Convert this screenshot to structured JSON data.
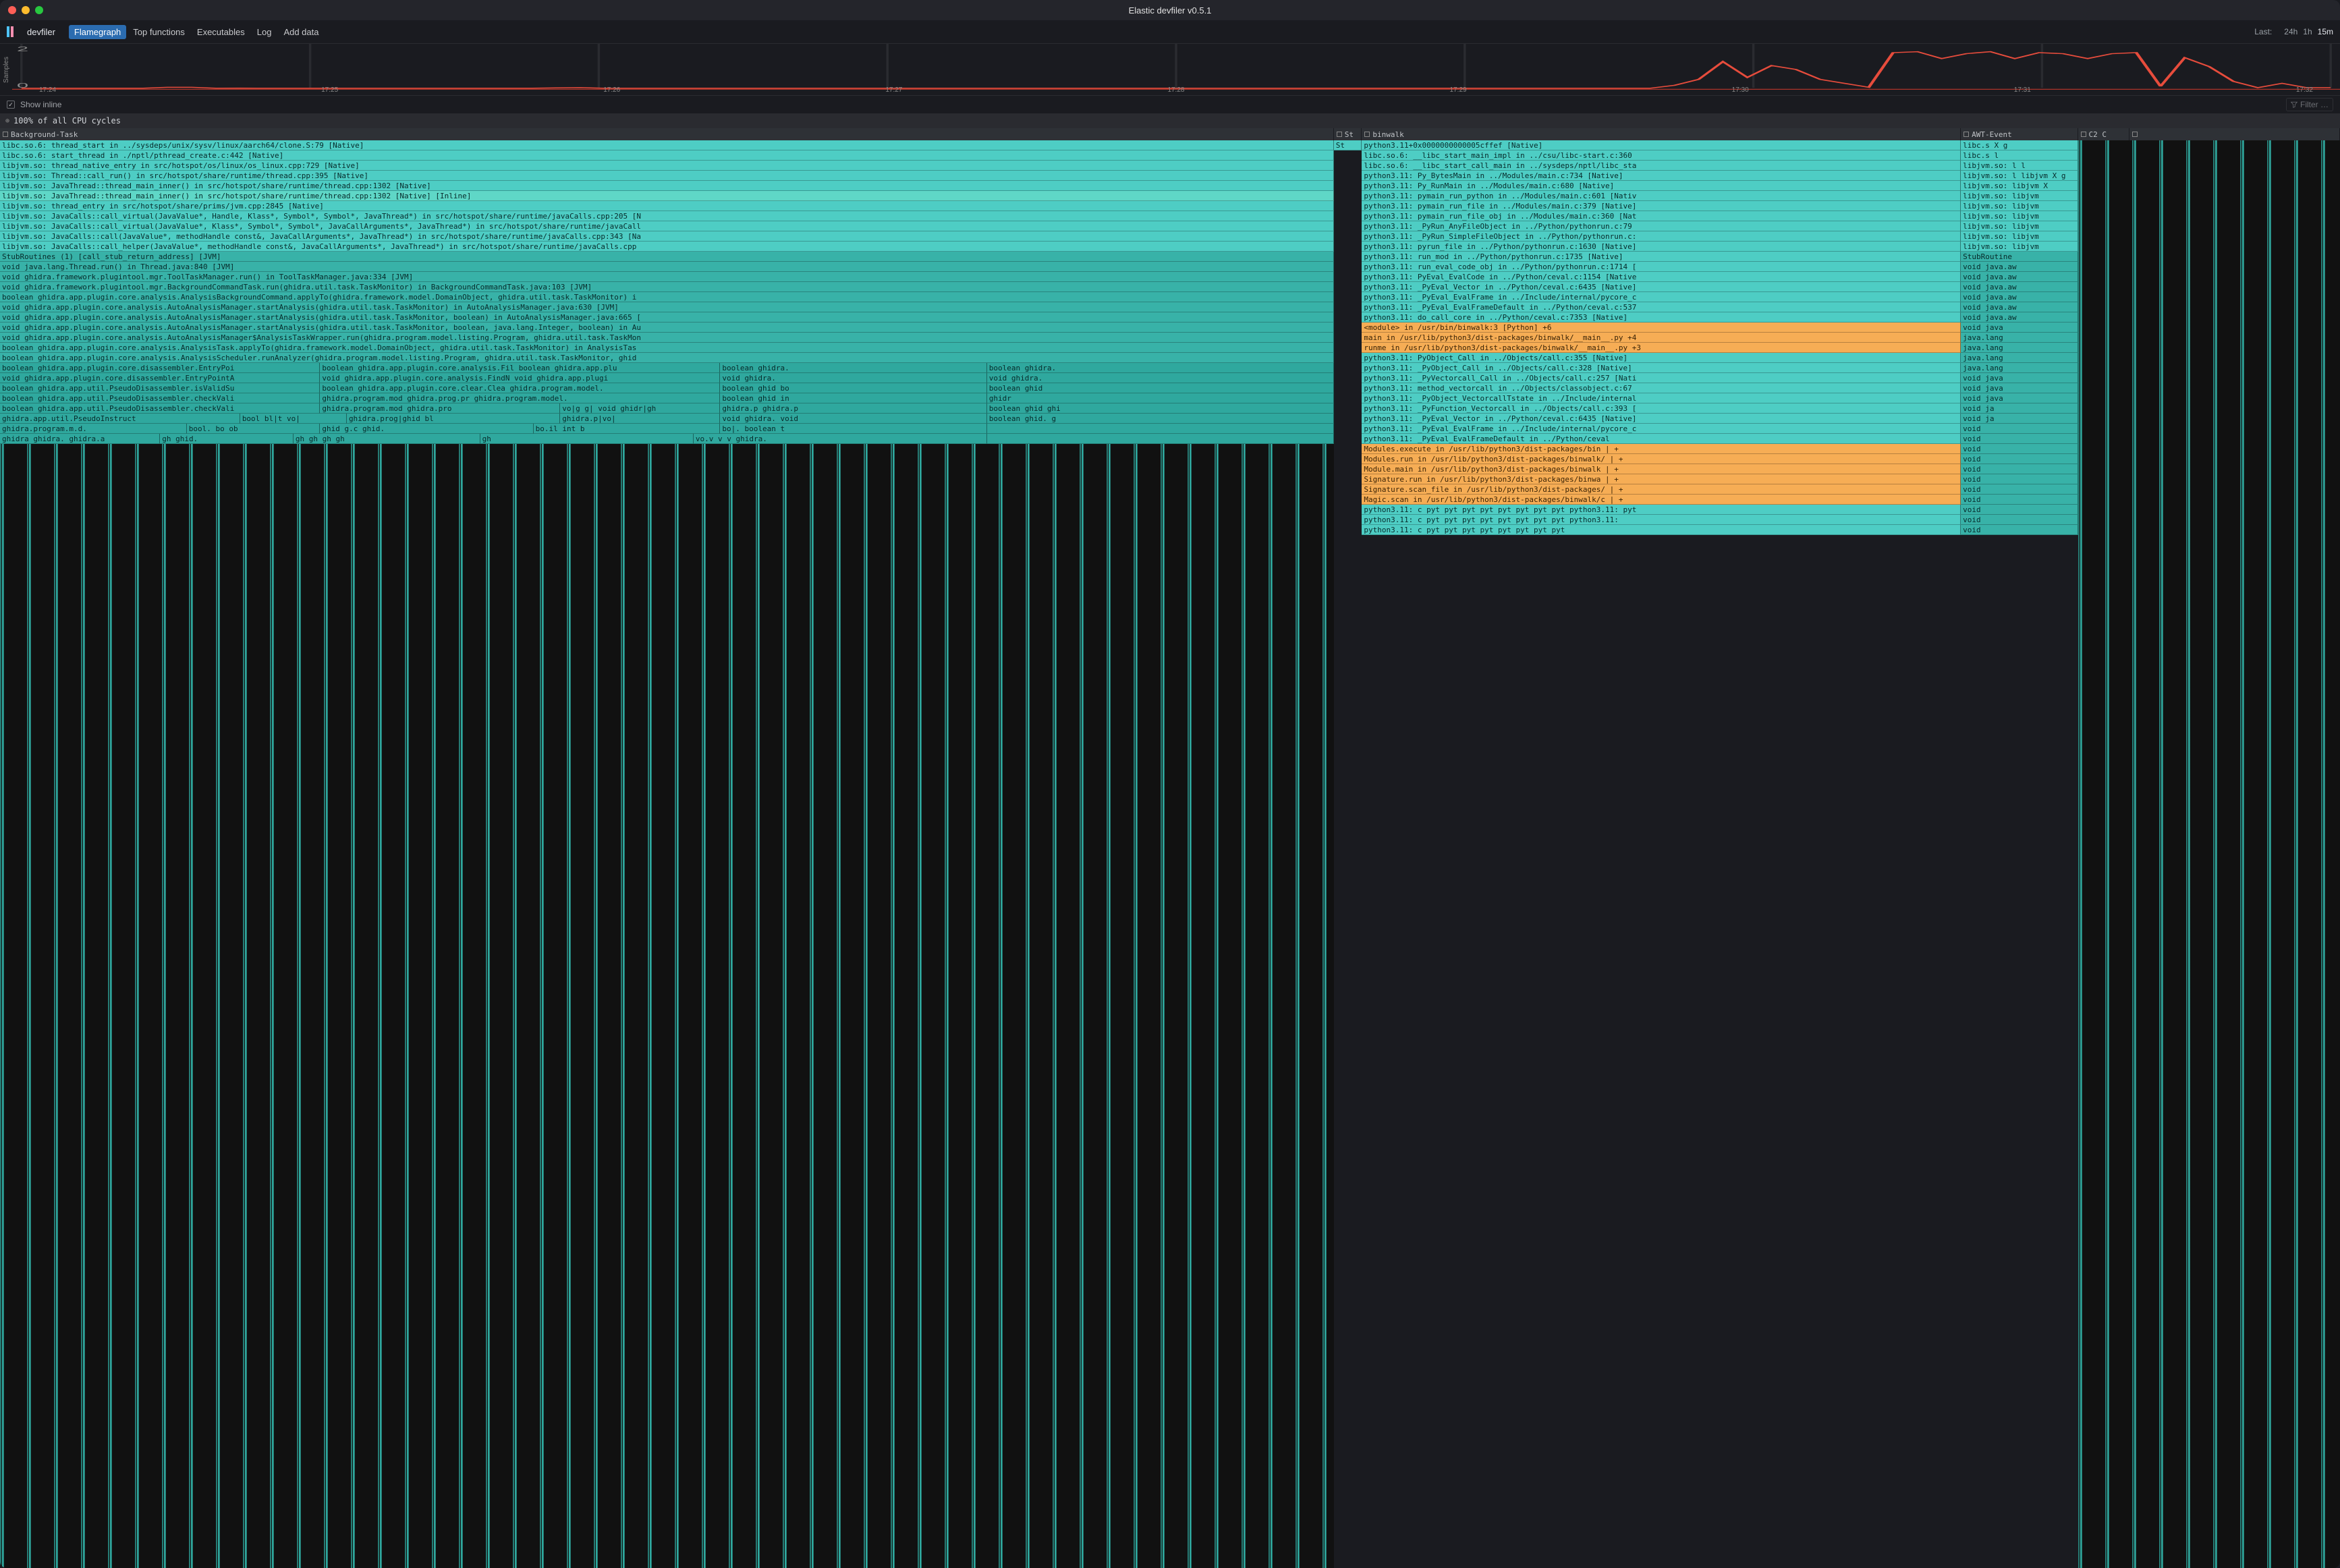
{
  "app": {
    "title": "Elastic devfiler v0.5.1",
    "brand": "devfiler"
  },
  "nav": {
    "items": [
      {
        "label": "Flamegraph",
        "active": true
      },
      {
        "label": "Top functions",
        "active": false
      },
      {
        "label": "Executables",
        "active": false
      },
      {
        "label": "Log",
        "active": false
      },
      {
        "label": "Add data",
        "active": false
      }
    ]
  },
  "time_range": {
    "label": "Last:",
    "options": [
      "24h",
      "1h",
      "15m"
    ],
    "active_index": 2
  },
  "spark": {
    "y_label": "Samples",
    "y_ticks": [
      "2",
      "0"
    ],
    "x_ticks": [
      "17:24",
      "17:25",
      "17:26",
      "17:27",
      "17:28",
      "17:29",
      "17:30",
      "17:31",
      "17:32"
    ]
  },
  "toolbar": {
    "show_inline_checked": true,
    "show_inline_label": "Show inline",
    "filter_placeholder": "Filter …"
  },
  "root": {
    "expand_icon": "⊕",
    "label": "100% of all CPU cycles"
  },
  "columns": [
    {
      "label": "Background-Task",
      "width": 57.0
    },
    {
      "label": "St",
      "width": 1.2
    },
    {
      "label": "binwalk",
      "width": 25.6
    },
    {
      "label": "AWT-Event",
      "width": 5.0
    },
    {
      "label": "C2 C",
      "width": 2.2
    },
    {
      "label": "",
      "width": 9.0
    }
  ],
  "stacks": {
    "java": [
      {
        "class": "c-native",
        "text": "libc.so.6: thread_start in ../sysdeps/unix/sysv/linux/aarch64/clone.S:79 [Native]"
      },
      {
        "class": "c-native",
        "text": "libc.so.6: start_thread in ./nptl/pthread_create.c:442 [Native]"
      },
      {
        "class": "c-native",
        "text": "libjvm.so: thread_native_entry in src/hotspot/os/linux/os_linux.cpp:729 [Native]"
      },
      {
        "class": "c-native",
        "text": "libjvm.so: Thread::call_run() in src/hotspot/share/runtime/thread.cpp:395 [Native]"
      },
      {
        "class": "c-native",
        "text": "libjvm.so: JavaThread::thread_main_inner() in src/hotspot/share/runtime/thread.cpp:1302 [Native]"
      },
      {
        "class": "c-inline",
        "text": "libjvm.so: JavaThread::thread_main_inner() in src/hotspot/share/runtime/thread.cpp:1302 [Native] [Inline]"
      },
      {
        "class": "c-native",
        "text": "libjvm.so: thread_entry in src/hotspot/share/prims/jvm.cpp:2845 [Native]"
      },
      {
        "class": "c-native",
        "text": "libjvm.so: JavaCalls::call_virtual(JavaValue*, Handle, Klass*, Symbol*, Symbol*, JavaThread*) in src/hotspot/share/runtime/javaCalls.cpp:205 [N"
      },
      {
        "class": "c-native",
        "text": "libjvm.so: JavaCalls::call_virtual(JavaValue*, Klass*, Symbol*, Symbol*, JavaCallArguments*, JavaThread*) in src/hotspot/share/runtime/javaCall"
      },
      {
        "class": "c-native",
        "text": "libjvm.so: JavaCalls::call(JavaValue*, methodHandle const&, JavaCallArguments*, JavaThread*) in src/hotspot/share/runtime/javaCalls.cpp:343 [Na"
      },
      {
        "class": "c-native",
        "text": "libjvm.so: JavaCalls::call_helper(JavaValue*, methodHandle const&, JavaCallArguments*, JavaThread*) in src/hotspot/share/runtime/javaCalls.cpp"
      },
      {
        "class": "c-stub",
        "text": "StubRoutines (1) [call_stub_return_address] [JVM]"
      },
      {
        "class": "c-jvm",
        "text": "void java.lang.Thread.run() in Thread.java:840 [JVM]"
      },
      {
        "class": "c-jvm",
        "text": "void ghidra.framework.plugintool.mgr.ToolTaskManager.run() in ToolTaskManager.java:334 [JVM]"
      },
      {
        "class": "c-jvm",
        "text": "void ghidra.framework.plugintool.mgr.BackgroundCommandTask.run(ghidra.util.task.TaskMonitor) in BackgroundCommandTask.java:103 [JVM]"
      },
      {
        "class": "c-jvm",
        "text": "boolean ghidra.app.plugin.core.analysis.AnalysisBackgroundCommand.applyTo(ghidra.framework.model.DomainObject, ghidra.util.task.TaskMonitor) i"
      },
      {
        "class": "c-jvm",
        "text": "void ghidra.app.plugin.core.analysis.AutoAnalysisManager.startAnalysis(ghidra.util.task.TaskMonitor) in AutoAnalysisManager.java:630 [JVM]"
      },
      {
        "class": "c-jvm",
        "text": "void ghidra.app.plugin.core.analysis.AutoAnalysisManager.startAnalysis(ghidra.util.task.TaskMonitor, boolean) in AutoAnalysisManager.java:665 ["
      },
      {
        "class": "c-jvm",
        "text": "void ghidra.app.plugin.core.analysis.AutoAnalysisManager.startAnalysis(ghidra.util.task.TaskMonitor, boolean, java.lang.Integer, boolean) in Au"
      },
      {
        "class": "c-jvm",
        "text": "void ghidra.app.plugin.core.analysis.AutoAnalysisManager$AnalysisTaskWrapper.run(ghidra.program.model.listing.Program, ghidra.util.task.TaskMon"
      },
      {
        "class": "c-jvm",
        "text": "boolean ghidra.app.plugin.core.analysis.AnalysisTask.applyTo(ghidra.framework.model.DomainObject, ghidra.util.task.TaskMonitor) in AnalysisTas"
      },
      {
        "class": "c-jvm",
        "text": "boolean ghidra.app.plugin.core.analysis.AnalysisScheduler.runAnalyzer(ghidra.program.model.listing.Program, ghidra.util.task.TaskMonitor, ghid"
      }
    ],
    "java_branches": [
      [
        {
          "class": "c-jvm2",
          "w": 24,
          "text": "boolean ghidra.app.plugin.core.disassembler.EntryPoi"
        },
        {
          "class": "c-jvm2",
          "w": 30,
          "text": "boolean ghidra.app.plugin.core.analysis.Fil boolean ghidra.app.plu"
        },
        {
          "class": "c-jvm2",
          "w": 20,
          "text": "boolean ghidra."
        },
        {
          "class": "c-jvm2",
          "w": 26,
          "text": "boolean ghidra."
        }
      ],
      [
        {
          "class": "c-jvm2",
          "w": 24,
          "text": "void ghidra.app.plugin.core.disassembler.EntryPointA"
        },
        {
          "class": "c-jvm2",
          "w": 30,
          "text": "void ghidra.app.plugin.core.analysis.FindN void ghidra.app.plugi"
        },
        {
          "class": "c-jvm2",
          "w": 20,
          "text": "void ghidra."
        },
        {
          "class": "c-jvm2",
          "w": 26,
          "text": "void ghidra."
        }
      ],
      [
        {
          "class": "c-jvm2",
          "w": 24,
          "text": "boolean ghidra.app.util.PseudoDisassembler.isValidSu"
        },
        {
          "class": "c-jvm2",
          "w": 30,
          "text": "boolean ghidra.app.plugin.core.clear.Clea  ghidra.program.model."
        },
        {
          "class": "c-jvm2",
          "w": 20,
          "text": "boolean ghid bo"
        },
        {
          "class": "c-jvm2",
          "w": 26,
          "text": "boolean ghid"
        }
      ],
      [
        {
          "class": "c-jvm2",
          "w": 24,
          "text": "boolean ghidra.app.util.PseudoDisassembler.checkVali"
        },
        {
          "class": "c-jvm2",
          "w": 30,
          "text": "ghidra.program.mod  ghidra.prog.pr  ghidra.program.model."
        },
        {
          "class": "c-jvm2",
          "w": 20,
          "text": "boolean ghid in"
        },
        {
          "class": "c-jvm2",
          "w": 26,
          "text": "ghidr"
        }
      ],
      [
        {
          "class": "c-jvm2",
          "w": 24,
          "text": "boolean ghidra.app.util.PseudoDisassembler.checkVali"
        },
        {
          "class": "c-jvm2",
          "w": 18,
          "text": "ghidra.program.mod  ghidra.pro"
        },
        {
          "class": "c-jvm2",
          "w": 12,
          "text": "vo|g g|  void ghidr|gh"
        },
        {
          "class": "c-jvm2",
          "w": 20,
          "text": "ghidra.p ghidra.p"
        },
        {
          "class": "c-jvm2",
          "w": 26,
          "text": "boolean ghid ghi"
        }
      ],
      [
        {
          "class": "c-jvm2",
          "w": 18,
          "text": "ghidra.app.util.PseudoInstruct"
        },
        {
          "class": "c-jvm2",
          "w": 8,
          "text": "bool bl|t vo|"
        },
        {
          "class": "c-jvm2",
          "w": 16,
          "text": "ghidra.prog|ghid bl"
        },
        {
          "class": "c-jvm2",
          "w": 12,
          "text": "ghidra.p|vo|"
        },
        {
          "class": "c-jvm2",
          "w": 20,
          "text": "void  ghidra.   void"
        },
        {
          "class": "c-jvm2",
          "w": 26,
          "text": "boolean ghid. g"
        }
      ],
      [
        {
          "class": "c-jvm2",
          "w": 14,
          "text": "ghidra.program.m.d."
        },
        {
          "class": "c-jvm2",
          "w": 10,
          "text": "bool. bo ob"
        },
        {
          "class": "c-jvm2",
          "w": 16,
          "text": "ghid g.c ghid."
        },
        {
          "class": "c-jvm2",
          "w": 14,
          "text": "bo.il  int   b"
        },
        {
          "class": "c-jvm2",
          "w": 20,
          "text": " bo|. boolean t"
        },
        {
          "class": "c-jvm2",
          "w": 26,
          "text": ""
        }
      ],
      [
        {
          "class": "c-jvm2",
          "w": 12,
          "text": "ghidra  ghidra. ghidra.a"
        },
        {
          "class": "c-jvm2",
          "w": 10,
          "text": "gh ghid."
        },
        {
          "class": "c-jvm2",
          "w": 14,
          "text": "gh gh gh gh  "
        },
        {
          "class": "c-jvm2",
          "w": 16,
          "text": "gh   "
        },
        {
          "class": "c-jvm2",
          "w": 22,
          "text": "vo.v v  v ghidra."
        },
        {
          "class": "c-jvm2",
          "w": 26,
          "text": ""
        }
      ]
    ],
    "st": [
      {
        "class": "c-native",
        "text": "St"
      }
    ],
    "python": [
      {
        "class": "c-native",
        "text": "python3.11+0x0000000000005cffef [Native]"
      },
      {
        "class": "c-native",
        "text": "libc.so.6: __libc_start_main_impl in ../csu/libc-start.c:360"
      },
      {
        "class": "c-native",
        "text": "libc.so.6: __libc_start_call_main in ../sysdeps/nptl/libc_sta"
      },
      {
        "class": "c-native",
        "text": "python3.11: Py_BytesMain in ../Modules/main.c:734 [Native]"
      },
      {
        "class": "c-native",
        "text": "python3.11: Py_RunMain in ../Modules/main.c:680 [Native]"
      },
      {
        "class": "c-native",
        "text": "python3.11: pymain_run_python in ../Modules/main.c:601 [Nativ"
      },
      {
        "class": "c-native",
        "text": "python3.11: pymain_run_file in ../Modules/main.c:379 [Native]"
      },
      {
        "class": "c-native",
        "text": "python3.11: pymain_run_file_obj in ../Modules/main.c:360 [Nat"
      },
      {
        "class": "c-native",
        "text": "python3.11: _PyRun_AnyFileObject in ../Python/pythonrun.c:79"
      },
      {
        "class": "c-native",
        "text": "python3.11: _PyRun_SimpleFileObject in ../Python/pythonrun.c:"
      },
      {
        "class": "c-native",
        "text": "python3.11: pyrun_file in ../Python/pythonrun.c:1630 [Native]"
      },
      {
        "class": "c-native",
        "text": "python3.11: run_mod in ../Python/pythonrun.c:1735 [Native]"
      },
      {
        "class": "c-native",
        "text": "python3.11: run_eval_code_obj in ../Python/pythonrun.c:1714 ["
      },
      {
        "class": "c-native",
        "text": "python3.11: PyEval_EvalCode in ../Python/ceval.c:1154 [Native"
      },
      {
        "class": "c-native",
        "text": "python3.11: _PyEval_Vector in ../Python/ceval.c:6435 [Native]"
      },
      {
        "class": "c-native",
        "text": "python3.11: _PyEval_EvalFrame in ../Include/internal/pycore_c"
      },
      {
        "class": "c-native",
        "text": "python3.11: _PyEval_EvalFrameDefault in ../Python/ceval.c:537"
      },
      {
        "class": "c-native",
        "text": "python3.11: do_call_core in ../Python/ceval.c:7353 [Native]"
      },
      {
        "class": "c-pyfile",
        "text": "<module> in /usr/bin/binwalk:3 [Python]                     +6"
      },
      {
        "class": "c-pyfile",
        "text": "main in /usr/lib/python3/dist-packages/binwalk/__main__.py  +4"
      },
      {
        "class": "c-pyfile",
        "text": "runme in /usr/lib/python3/dist-packages/binwalk/__main__.py +3"
      },
      {
        "class": "c-native",
        "text": "python3.11: PyObject_Call in ../Objects/call.c:355 [Native]"
      },
      {
        "class": "c-native",
        "text": "python3.11: _PyObject_Call in ../Objects/call.c:328 [Native]"
      },
      {
        "class": "c-native",
        "text": "python3.11: _PyVectorcall_Call in ../Objects/call.c:257 [Nati"
      },
      {
        "class": "c-native",
        "text": "python3.11: method_vectorcall in ../Objects/classobject.c:67"
      },
      {
        "class": "c-native",
        "text": "python3.11: _PyObject_VectorcallTstate in ../Include/internal"
      },
      {
        "class": "c-native",
        "text": "python3.11: _PyFunction_Vectorcall in ../Objects/call.c:393 ["
      },
      {
        "class": "c-native",
        "text": "python3.11: _PyEval_Vector in ../Python/ceval.c:6435 [Native]"
      },
      {
        "class": "c-native",
        "text": "python3.11: _PyEval_EvalFrame in ../Include/internal/pycore_c"
      },
      {
        "class": "c-native",
        "text": "python3.11: _PyEval_EvalFrameDefault in ../Python/ceval"
      },
      {
        "class": "c-pyfile",
        "text": "Modules.execute in /usr/lib/python3/dist-packages/bin  | + "
      },
      {
        "class": "c-pyfile",
        "text": "Modules.run in /usr/lib/python3/dist-packages/binwalk/ | + "
      },
      {
        "class": "c-pyfile",
        "text": "Module.main in /usr/lib/python3/dist-packages/binwalk  | + "
      },
      {
        "class": "c-pyfile",
        "text": "Signature.run in /usr/lib/python3/dist-packages/binwa  | + "
      },
      {
        "class": "c-pyfile",
        "text": "Signature.scan_file in /usr/lib/python3/dist-packages/ | + "
      },
      {
        "class": "c-pyfile",
        "text": "Magic.scan in /usr/lib/python3/dist-packages/binwalk/c | + "
      },
      {
        "class": "c-native",
        "text": "python3.11: c pyt pyt pyt pyt pyt pyt pyt pyt python3.11: pyt"
      },
      {
        "class": "c-native",
        "text": "python3.11: c pyt pyt pyt pyt pyt pyt pyt pyt python3.11:"
      },
      {
        "class": "c-native",
        "text": "python3.11: c pyt pyt pyt pyt pyt pyt pyt pyt"
      }
    ],
    "awt": [
      {
        "class": "c-native",
        "text": "libc.s X g"
      },
      {
        "class": "c-native",
        "text": "libc.s l"
      },
      {
        "class": "c-native",
        "text": "libjvm.so: l l"
      },
      {
        "class": "c-native",
        "text": "libjvm.so: l libjvm X g"
      },
      {
        "class": "c-native",
        "text": "libjvm.so:  libjvm X"
      },
      {
        "class": "c-native",
        "text": "libjvm.so:  libjvm"
      },
      {
        "class": "c-native",
        "text": "libjvm.so:  libjvm"
      },
      {
        "class": "c-native",
        "text": "libjvm.so:  libjvm"
      },
      {
        "class": "c-native",
        "text": "libjvm.so:  libjvm"
      },
      {
        "class": "c-native",
        "text": "libjvm.so:  libjvm"
      },
      {
        "class": "c-native",
        "text": "libjvm.so:  libjvm"
      },
      {
        "class": "c-stub",
        "text": "StubRoutine"
      },
      {
        "class": "c-jvm",
        "text": "void java.aw"
      },
      {
        "class": "c-jvm",
        "text": "void java.aw"
      },
      {
        "class": "c-jvm",
        "text": "void java.aw"
      },
      {
        "class": "c-jvm",
        "text": "void java.aw"
      },
      {
        "class": "c-jvm",
        "text": "void java.aw"
      },
      {
        "class": "c-jvm",
        "text": "void java.aw"
      },
      {
        "class": "c-jvm",
        "text": "void java"
      },
      {
        "class": "c-jvm",
        "text": "java.lang"
      },
      {
        "class": "c-jvm",
        "text": "java.lang"
      },
      {
        "class": "c-jvm",
        "text": "java.lang"
      },
      {
        "class": "c-jvm",
        "text": "java.lang"
      },
      {
        "class": "c-jvm",
        "text": "void java"
      },
      {
        "class": "c-jvm",
        "text": "void java"
      },
      {
        "class": "c-jvm",
        "text": "void java"
      },
      {
        "class": "c-jvm",
        "text": "void ja"
      },
      {
        "class": "c-jvm",
        "text": "void ja"
      },
      {
        "class": "c-jvm",
        "text": "void"
      },
      {
        "class": "c-jvm",
        "text": "void"
      },
      {
        "class": "c-jvm",
        "text": "void"
      },
      {
        "class": "c-jvm",
        "text": "void"
      },
      {
        "class": "c-jvm",
        "text": "void"
      },
      {
        "class": "c-jvm",
        "text": "void"
      },
      {
        "class": "c-jvm",
        "text": "void"
      },
      {
        "class": "c-jvm",
        "text": "void"
      },
      {
        "class": "c-jvm",
        "text": "void"
      },
      {
        "class": "c-jvm",
        "text": "void"
      },
      {
        "class": "c-jvm",
        "text": "void"
      }
    ]
  },
  "chart_data": {
    "type": "line",
    "title": "",
    "xlabel": "",
    "ylabel": "Samples",
    "ylim": [
      0,
      2
    ],
    "x": [
      "17:24",
      "17:25",
      "17:26",
      "17:27",
      "17:28",
      "17:29",
      "17:30",
      "17:31",
      "17:32"
    ],
    "series": [
      {
        "name": "samples",
        "color": "#e74c3c",
        "values": [
          0.05,
          0.05,
          0.05,
          0.05,
          0.05,
          0.05,
          0.1,
          0.1,
          0.05,
          0.06,
          0.05,
          0.05,
          0.05,
          0.05,
          0.05,
          0.05,
          0.05,
          0.05,
          0.05,
          0.05,
          0.05,
          0.05,
          0.07,
          0.08,
          0.05,
          0.05,
          0.05,
          0.05,
          0.05,
          0.05,
          0.05,
          0.05,
          0.05,
          0.05,
          0.05,
          0.05,
          0.05,
          0.05,
          0.05,
          0.05,
          0.05,
          0.05,
          0.05,
          0.05,
          0.05,
          0.05,
          0.05,
          0.05,
          0.05,
          0.05,
          0.05,
          0.05,
          0.05,
          0.05,
          0.05,
          0.05,
          0.05,
          0.05,
          0.05,
          0.05,
          0.05,
          0.05,
          0.05,
          0.05,
          0.05,
          0.05,
          0.05,
          0.05,
          0.2,
          0.5,
          1.4,
          0.6,
          1.2,
          1.0,
          0.5,
          0.3,
          0.1,
          1.85,
          1.9,
          1.55,
          1.8,
          1.9,
          1.55,
          1.85,
          1.8,
          1.55,
          1.8,
          1.85,
          0.15,
          1.6,
          1.15,
          0.4,
          0.08,
          0.3,
          0.08,
          0.08
        ]
      }
    ]
  },
  "colors": {
    "native": "#4ecdc4",
    "jvm": "#38b2a8",
    "jvm2": "#2fa89e",
    "inline": "#5fd7c7",
    "python": "#4ecdc4",
    "pyfile": "#f6ad55",
    "accent": "#2b6cb0",
    "spark": "#e74c3c",
    "bg": "#1a1b20",
    "panel": "#24252b"
  }
}
